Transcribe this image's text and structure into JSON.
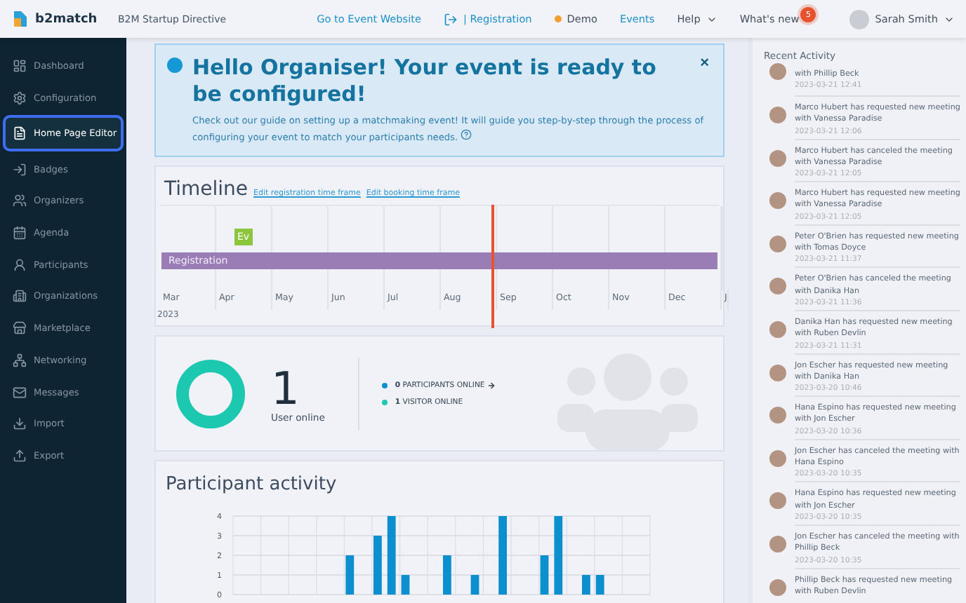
{
  "topbar": {
    "brand": "b2match",
    "event_name": "B2M Startup Directive",
    "links": [
      {
        "label": "Go to Event Website",
        "kind": "link"
      },
      {
        "label": "| Registration",
        "kind": "link"
      },
      {
        "label": "Demo",
        "kind": "status",
        "color": "#f0a030"
      },
      {
        "label": "Events",
        "kind": "link"
      },
      {
        "label": "Help",
        "kind": "menu"
      },
      {
        "label": "What's new",
        "kind": "news",
        "badge": "5"
      }
    ],
    "user": "Sarah Smith"
  },
  "sidebar": {
    "items": [
      {
        "label": "Dashboard",
        "selected": false
      },
      {
        "label": "Configuration",
        "selected": false
      },
      {
        "label": "Home Page Editor",
        "selected": true
      },
      {
        "label": "Badges",
        "selected": false
      },
      {
        "label": "Organizers",
        "selected": false
      },
      {
        "label": "Agenda",
        "selected": false
      },
      {
        "label": "Participants",
        "selected": false
      },
      {
        "label": "Organizations",
        "selected": false
      },
      {
        "label": "Marketplace",
        "selected": false
      },
      {
        "label": "Networking",
        "selected": false
      },
      {
        "label": "Messages",
        "selected": false
      },
      {
        "label": "Import",
        "selected": false
      },
      {
        "label": "Export",
        "selected": false
      }
    ]
  },
  "banner": {
    "title": "Hello Organiser! Your event is ready to be configured!",
    "text": "Check out our guide on setting up a matchmaking event! It will guide you step-by-step through the process of configuring your event to match your participants needs.",
    "close": "×"
  },
  "timeline": {
    "title": "Timeline",
    "links": [
      "Edit registration time frame",
      "Edit booking time frame"
    ],
    "months": [
      "Mar",
      "Apr",
      "May",
      "Jun",
      "Jul",
      "Aug",
      "Sep",
      "Oct",
      "Nov",
      "Dec",
      "J"
    ],
    "year": "2023",
    "event_label": "Ev",
    "registration_label": "Registration"
  },
  "online": {
    "count": "1",
    "label": "User online",
    "legend": [
      {
        "text": "**0** PARTICIPANTS ONLINE",
        "color": "#0d8fd0",
        "kind": "link"
      },
      {
        "text": "**1** VISITOR ONLINE",
        "color": "#1cc8b0",
        "kind": "plain"
      }
    ]
  },
  "activity_chart": {
    "title": "Participant activity",
    "chart_data": {
      "type": "bar",
      "grid": true,
      "ylim": [
        0,
        4
      ],
      "yticks": [
        0,
        1,
        2,
        3,
        4
      ],
      "values": [
        0,
        0,
        0,
        0,
        0,
        0,
        0,
        0,
        2,
        0,
        3,
        4,
        1,
        0,
        0,
        2,
        0,
        1,
        0,
        4,
        0,
        0,
        2,
        4,
        0,
        1,
        1,
        0,
        0,
        0
      ]
    }
  },
  "recent_activity": {
    "title": "Recent Activity",
    "items": [
      {
        "text": "with Phillip Beck",
        "time": "2023-03-21 12:41"
      },
      {
        "text": "Marco Hubert has requested new meeting with Vanessa Paradise",
        "time": "2023-03-21 12:06"
      },
      {
        "text": "Marco Hubert has canceled the meeting with Vanessa Paradise",
        "time": "2023-03-21 12:05"
      },
      {
        "text": "Marco Hubert has requested new meeting with Vanessa Paradise",
        "time": "2023-03-21 12:05"
      },
      {
        "text": "Peter O'Brien has requested new meeting with Tomas Doyce",
        "time": "2023-03-21 11:37"
      },
      {
        "text": "Peter O'Brien has canceled the meeting with Danika Han",
        "time": "2023-03-21 11:36"
      },
      {
        "text": "Danika Han has requested new meeting with Ruben Devlin",
        "time": "2023-03-21 11:31"
      },
      {
        "text": "Jon Escher has requested new meeting with Danika Han",
        "time": "2023-03-20 10:46"
      },
      {
        "text": "Hana Espino has requested new meeting with Jon Escher",
        "time": "2023-03-20 10:36"
      },
      {
        "text": "Jon Escher has canceled the meeting with Hana Espino",
        "time": "2023-03-20 10:35"
      },
      {
        "text": "Hana Espino has requested new meeting with Jon Escher",
        "time": "2023-03-20 10:35"
      },
      {
        "text": "Jon Escher has canceled the meeting with Phillip Beck",
        "time": "2023-03-20 10:35"
      },
      {
        "text": "Phillip Beck has requested new meeting with Ruben Devlin"
      }
    ]
  }
}
